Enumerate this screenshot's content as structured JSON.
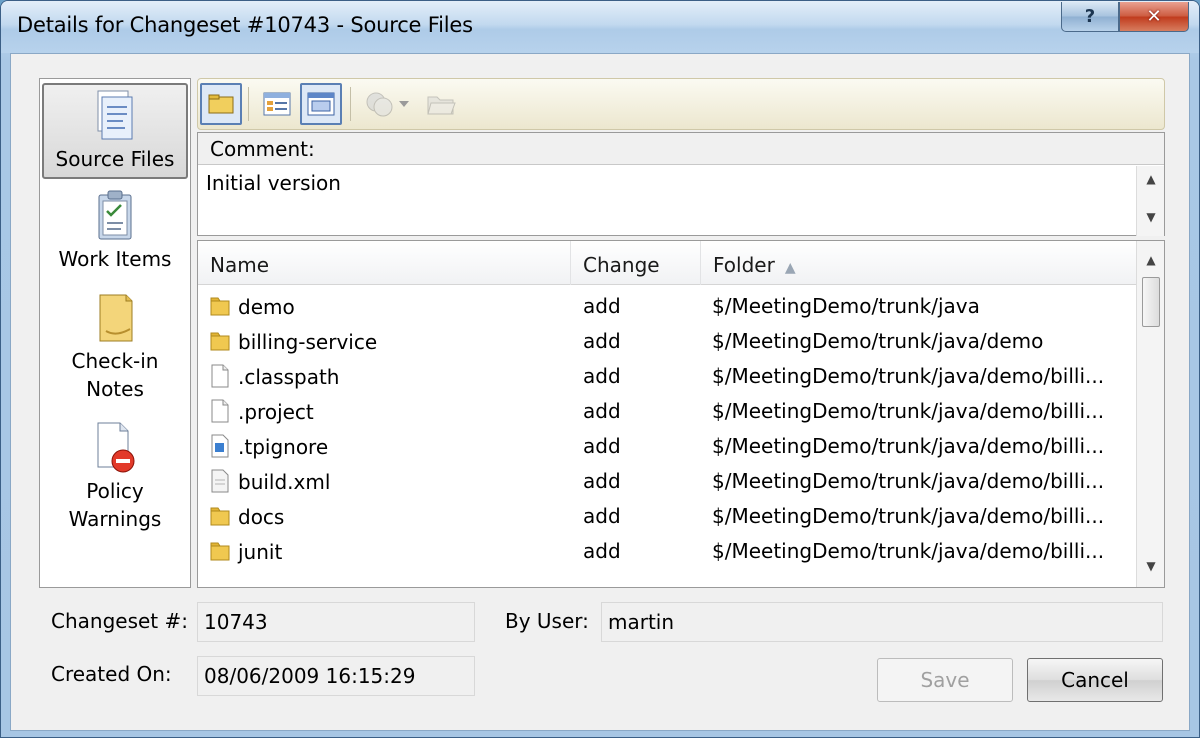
{
  "window": {
    "title": "Details for Changeset #10743 - Source Files",
    "help_label": "?",
    "close_label": "✕"
  },
  "nav": {
    "items": [
      {
        "label": "Source Files",
        "icon": "source-files-icon",
        "active": true
      },
      {
        "label": "Work Items",
        "icon": "work-items-icon"
      },
      {
        "label": "Check-in Notes",
        "icon": "check-in-notes-icon"
      },
      {
        "label": "Policy Warnings",
        "icon": "policy-warnings-icon"
      }
    ]
  },
  "toolbar": {
    "icons": [
      "folder-view-icon",
      "details-view-icon",
      "list-view-icon",
      "compare-icon",
      "dropdown-arrow-icon",
      "open-folder-icon"
    ]
  },
  "comment": {
    "label": "Comment:",
    "text": "Initial version"
  },
  "file_list": {
    "columns": [
      {
        "label": "Name"
      },
      {
        "label": "Change"
      },
      {
        "label": "Folder",
        "sort": "ascending"
      }
    ],
    "rows": [
      {
        "name": "demo",
        "type": "folder",
        "change": "add",
        "folder": "$/MeetingDemo/trunk/java"
      },
      {
        "name": "billing-service",
        "type": "folder",
        "change": "add",
        "folder": "$/MeetingDemo/trunk/java/demo"
      },
      {
        "name": ".classpath",
        "type": "file",
        "change": "add",
        "folder": "$/MeetingDemo/trunk/java/demo/billi..."
      },
      {
        "name": ".project",
        "type": "file",
        "change": "add",
        "folder": "$/MeetingDemo/trunk/java/demo/billi..."
      },
      {
        "name": ".tpignore",
        "type": "special",
        "change": "add",
        "folder": "$/MeetingDemo/trunk/java/demo/billi..."
      },
      {
        "name": "build.xml",
        "type": "xml",
        "change": "add",
        "folder": "$/MeetingDemo/trunk/java/demo/billi..."
      },
      {
        "name": "docs",
        "type": "folder",
        "change": "add",
        "folder": "$/MeetingDemo/trunk/java/demo/billi..."
      },
      {
        "name": "junit",
        "type": "folder",
        "change": "add",
        "folder": "$/MeetingDemo/trunk/java/demo/billi..."
      }
    ]
  },
  "details": {
    "changeset_label": "Changeset #:",
    "changeset_value": "10743",
    "user_label": "By User:",
    "user_value": "martin",
    "created_label": "Created On:",
    "created_value": "08/06/2009 16:15:29"
  },
  "buttons": {
    "save": "Save",
    "cancel": "Cancel"
  }
}
